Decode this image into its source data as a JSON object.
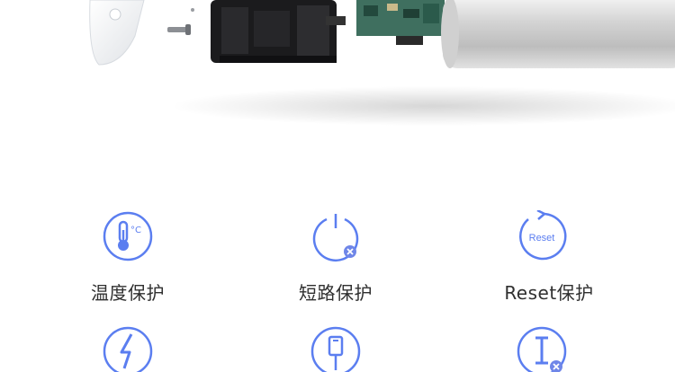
{
  "features": [
    {
      "label": "温度保护",
      "icon": "thermometer-icon",
      "unit": "°C"
    },
    {
      "label": "短路保护",
      "icon": "power-short-circuit-icon"
    },
    {
      "label": "Reset保护",
      "icon": "reset-icon",
      "text": "Reset"
    },
    {
      "label": "",
      "icon": "lightning-icon"
    },
    {
      "label": "",
      "icon": "usb-cable-icon"
    },
    {
      "label": "",
      "icon": "current-icon"
    }
  ],
  "colors": {
    "accent": "#5b7ef0",
    "text": "#2f2f2f",
    "badge": "#6f86e8"
  }
}
